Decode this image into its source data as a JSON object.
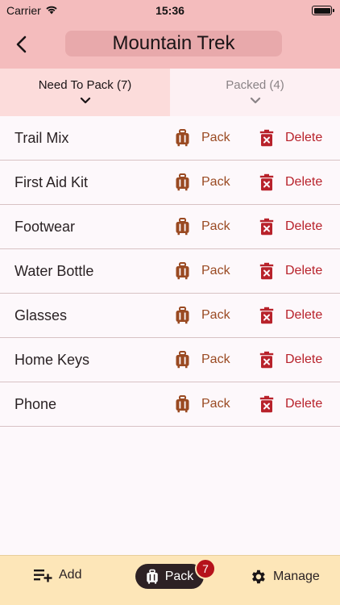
{
  "status_bar": {
    "carrier": "Carrier",
    "time": "15:36"
  },
  "header": {
    "title": "Mountain Trek"
  },
  "tabs": [
    {
      "label": "Need To Pack (7)",
      "active": true
    },
    {
      "label": "Packed (4)",
      "active": false
    }
  ],
  "items": [
    {
      "name": "Trail Mix",
      "pack_label": "Pack",
      "delete_label": "Delete"
    },
    {
      "name": "First Aid Kit",
      "pack_label": "Pack",
      "delete_label": "Delete"
    },
    {
      "name": "Footwear",
      "pack_label": "Pack",
      "delete_label": "Delete"
    },
    {
      "name": "Water Bottle",
      "pack_label": "Pack",
      "delete_label": "Delete"
    },
    {
      "name": "Glasses",
      "pack_label": "Pack",
      "delete_label": "Delete"
    },
    {
      "name": "Home Keys",
      "pack_label": "Pack",
      "delete_label": "Delete"
    },
    {
      "name": "Phone",
      "pack_label": "Pack",
      "delete_label": "Delete"
    }
  ],
  "bottom_bar": {
    "add_label": "Add",
    "pack_label": "Pack",
    "pack_badge": "7",
    "manage_label": "Manage"
  },
  "colors": {
    "header_bg": "#f4bcbd",
    "pack_accent": "#9a4a22",
    "delete_accent": "#b8222b",
    "bottom_bg": "#fde6b8",
    "badge": "#b5121b"
  },
  "icons": {
    "back": "chevron-left-icon",
    "tab_chevron": "chevron-down-icon",
    "pack": "suitcase-icon",
    "delete": "trash-icon",
    "add": "add-list-icon",
    "manage": "gear-icon"
  }
}
